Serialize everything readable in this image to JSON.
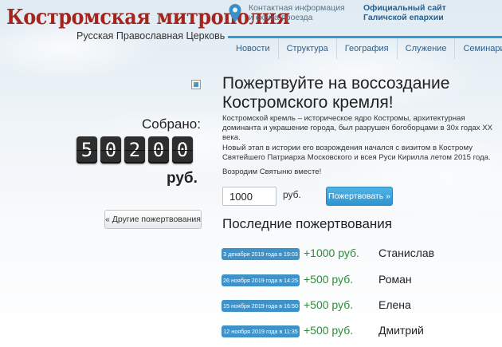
{
  "header": {
    "logo_title": "Костромская митрополия",
    "logo_subtitle": "Русская Православная Церковь",
    "contact_line1": "Контактная информация",
    "contact_line2": "и схема проезда",
    "official_line1": "Официальный сайт",
    "official_line2": "Галичской епархии"
  },
  "nav": {
    "items": [
      "Новости",
      "Структура",
      "География",
      "Служение",
      "Семинария"
    ]
  },
  "sidebar": {
    "raised_label": "Собрано:",
    "digits": [
      "5",
      "0",
      "2",
      "0",
      "0"
    ],
    "currency": "руб.",
    "other_donations_button": "« Другие пожертвования"
  },
  "main": {
    "headline_line1": "Пожертвуйте на воссоздание",
    "headline_line2": "Костромского кремля!",
    "description": [
      "Костромской кремль – историческое ядро Костромы, архитектурная доминанта и украшение города, был разрушен богоборцами в 30х годах XX века.",
      "Новый этап в истории его возрождения начался с визитом в Кострому Святейшего Патриарха Московского и всея Руси Кирилла летом 2015 года."
    ],
    "appeal": "Возродим Святыню вместе!",
    "amount_value": "1000",
    "amount_currency": "руб.",
    "donate_button": "Пожертвовать »",
    "recent_title": "Последние пожертвования",
    "recent": [
      {
        "date": "3 декабря 2019 года в 19:03",
        "amount": "+1000 руб.",
        "name": "Станислав"
      },
      {
        "date": "26 ноября 2019 года в 14:25",
        "amount": "+500 руб.",
        "name": "Роман"
      },
      {
        "date": "15 ноября 2019 года в 16:50",
        "amount": "+500 руб.",
        "name": "Елена"
      },
      {
        "date": "12 ноября 2019 года в 11:35",
        "amount": "+500 руб.",
        "name": "Дмитрий"
      }
    ]
  },
  "colors": {
    "brand_red": "#a5241d",
    "nav_accent": "#2f9ad4",
    "date_badge": "#3c92c9",
    "amount_green": "#2e8b3a"
  },
  "icons": [
    "map-pin-icon",
    "broken-image-icon"
  ]
}
